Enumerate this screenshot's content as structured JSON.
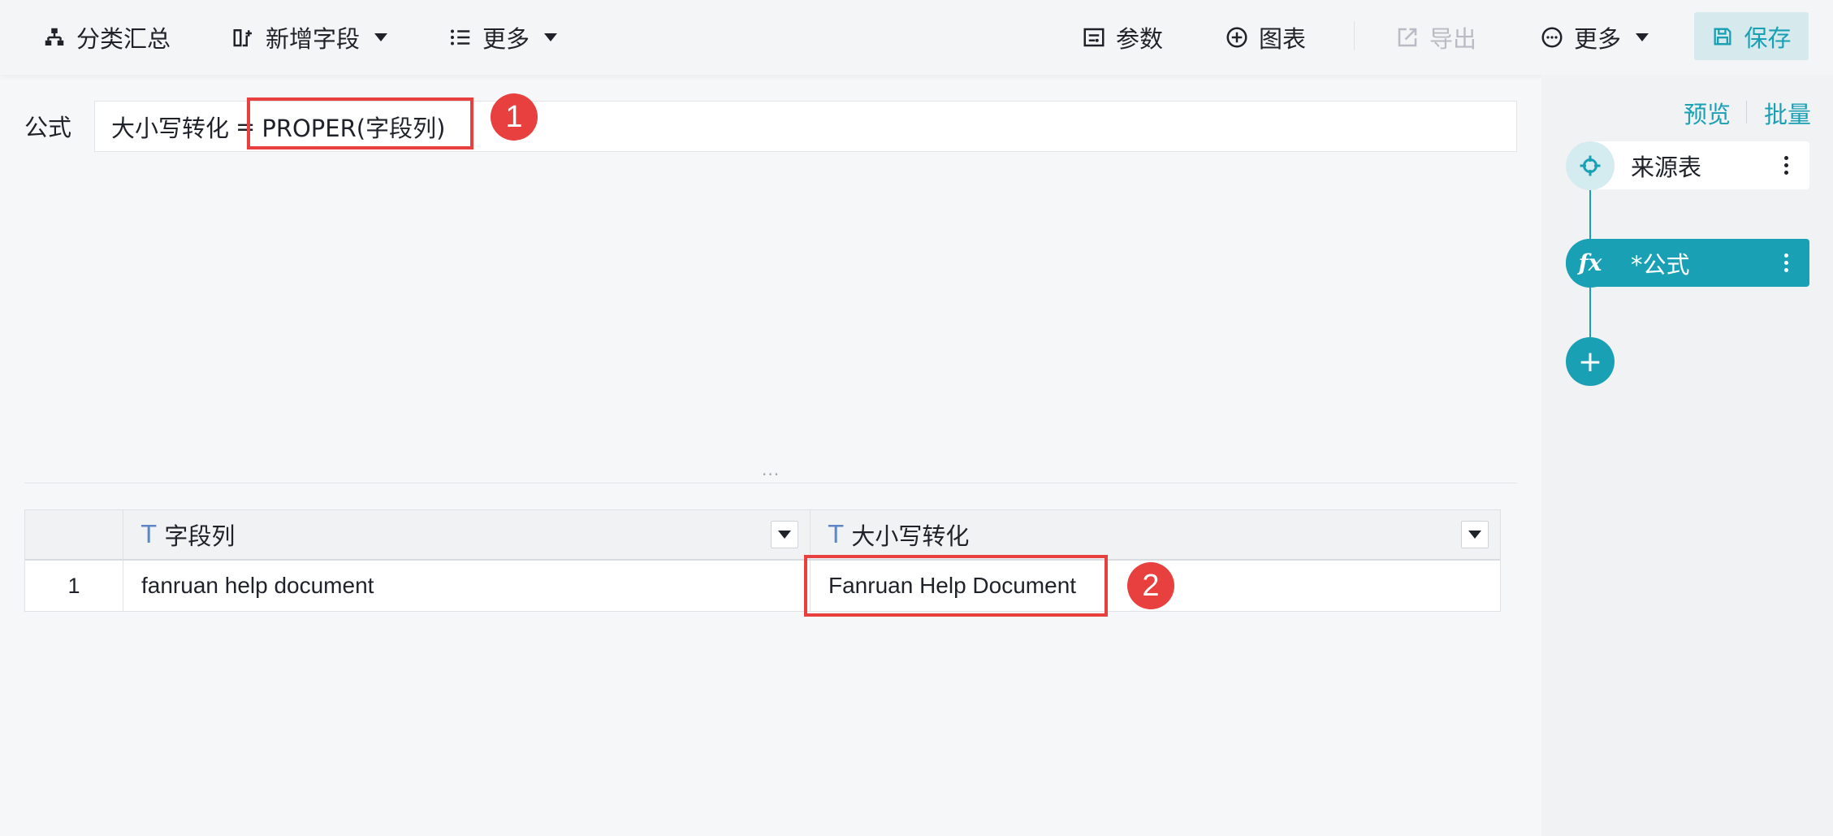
{
  "toolbar": {
    "group_summary": "分类汇总",
    "add_field": "新增字段",
    "more_left": "更多",
    "params": "参数",
    "chart": "图表",
    "export": "导出",
    "more_right": "更多",
    "save": "保存"
  },
  "formula": {
    "label": "公式",
    "field_name": "大小写转化",
    "equals": "=",
    "expression": "PROPER(字段列)"
  },
  "annotations": {
    "badge_1": "1",
    "badge_2": "2"
  },
  "splitter": {
    "handle": "..."
  },
  "table": {
    "columns": [
      {
        "type_icon": "T",
        "name": "字段列"
      },
      {
        "type_icon": "T",
        "name": "大小写转化"
      }
    ],
    "rows": [
      {
        "index": "1",
        "cells": [
          "fanruan help document",
          "Fanruan Help Document"
        ]
      }
    ]
  },
  "right_panel": {
    "preview": "预览",
    "batch": "批量",
    "steps": [
      {
        "label": "来源表",
        "icon": "crosshair-icon"
      },
      {
        "label": "*公式",
        "icon": "fx-icon",
        "icon_text": "fx",
        "active": true
      }
    ],
    "add_label": "+"
  },
  "colors": {
    "accent": "#1aa0b4",
    "highlight": "#e8403f"
  }
}
